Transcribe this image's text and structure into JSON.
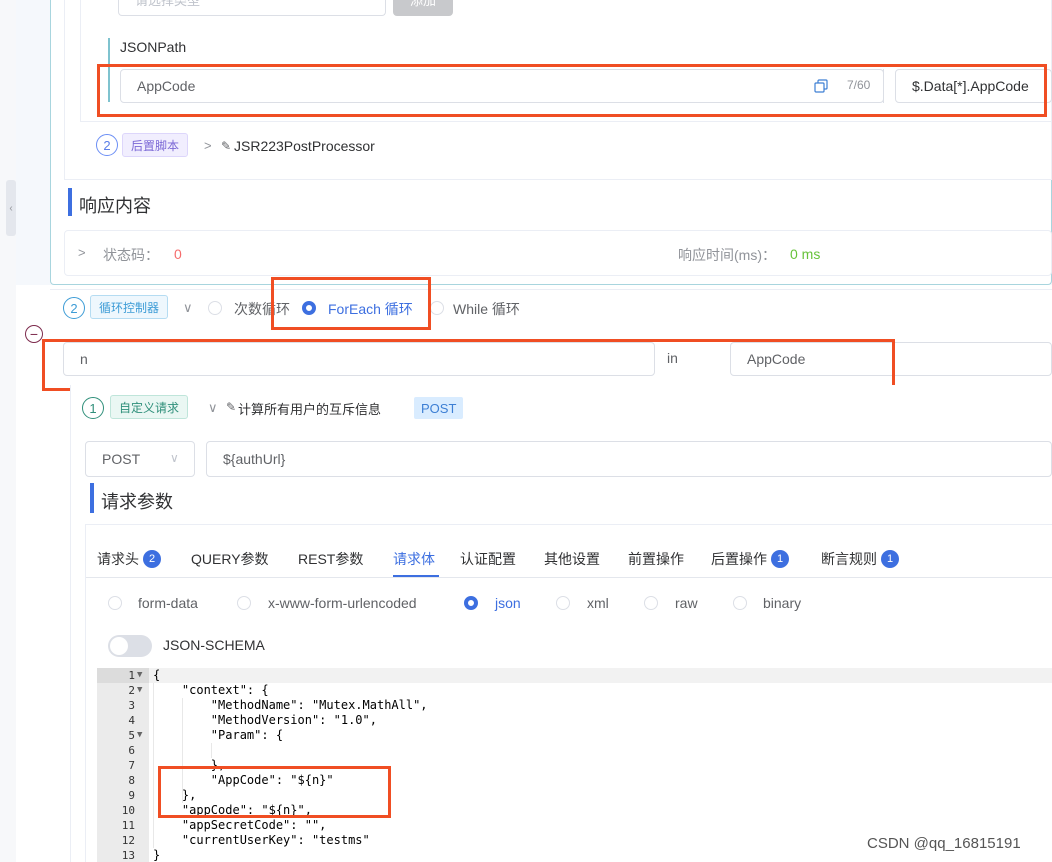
{
  "upper": {
    "type_select_placeholder": "请选择类型",
    "add_button": "添加",
    "jsonpath_label": "JSONPath",
    "var_name": "AppCode",
    "char_count": "7/60",
    "jsonpath_value": "$.Data[*].AppCode",
    "post_step_number": "2",
    "post_tag": "后置脚本",
    "post_name": "JSR223PostProcessor"
  },
  "response": {
    "title": "响应内容",
    "status_label": "状态码：",
    "status_value": "0",
    "time_label": "响应时间(ms)：",
    "time_value": "0 ms"
  },
  "loop": {
    "step_number": "2",
    "tag": "循环控制器",
    "options": [
      "次数循环",
      "ForEach 循环",
      "While 循环"
    ],
    "selected": "ForEach 循环",
    "variable": "n",
    "in_label": "in",
    "collection": "AppCode"
  },
  "request": {
    "step_number": "1",
    "tag": "自定义请求",
    "name": "计算所有用户的互斥信息",
    "method_badge": "POST",
    "method": "POST",
    "url": "${authUrl}",
    "params_title": "请求参数",
    "tabs": [
      {
        "label": "请求头",
        "badge": "2"
      },
      {
        "label": "QUERY参数",
        "badge": ""
      },
      {
        "label": "REST参数",
        "badge": ""
      },
      {
        "label": "请求体",
        "badge": ""
      },
      {
        "label": "认证配置",
        "badge": ""
      },
      {
        "label": "其他设置",
        "badge": ""
      },
      {
        "label": "前置操作",
        "badge": ""
      },
      {
        "label": "后置操作",
        "badge": "1"
      },
      {
        "label": "断言规则",
        "badge": "1"
      }
    ],
    "active_tab": "请求体",
    "body_types": [
      "form-data",
      "x-www-form-urlencoded",
      "json",
      "xml",
      "raw",
      "binary"
    ],
    "active_body_type": "json",
    "json_schema_label": "JSON-SCHEMA"
  },
  "code": {
    "line_numbers": [
      "1",
      "2",
      "3",
      "4",
      "5",
      "6",
      "7",
      "8",
      "9",
      "10",
      "11",
      "12",
      "13"
    ],
    "lines": [
      "{",
      "    \"context\": {",
      "        \"MethodName\": \"Mutex.MathAll\",",
      "        \"MethodVersion\": \"1.0\",",
      "        \"Param\": {",
      "",
      "        },",
      "        \"AppCode\": \"${n}\"",
      "    },",
      "    \"appCode\": \"${n}\",",
      "    \"appSecretCode\": \"\",",
      "    \"currentUserKey\": \"testms\"",
      "}"
    ]
  },
  "watermark": "CSDN @qq_16815191",
  "colors": {
    "accent": "#3d6fe0",
    "highlight_box": "#f04e23",
    "status_error": "#f56c6c",
    "status_ok": "#67c23a"
  }
}
